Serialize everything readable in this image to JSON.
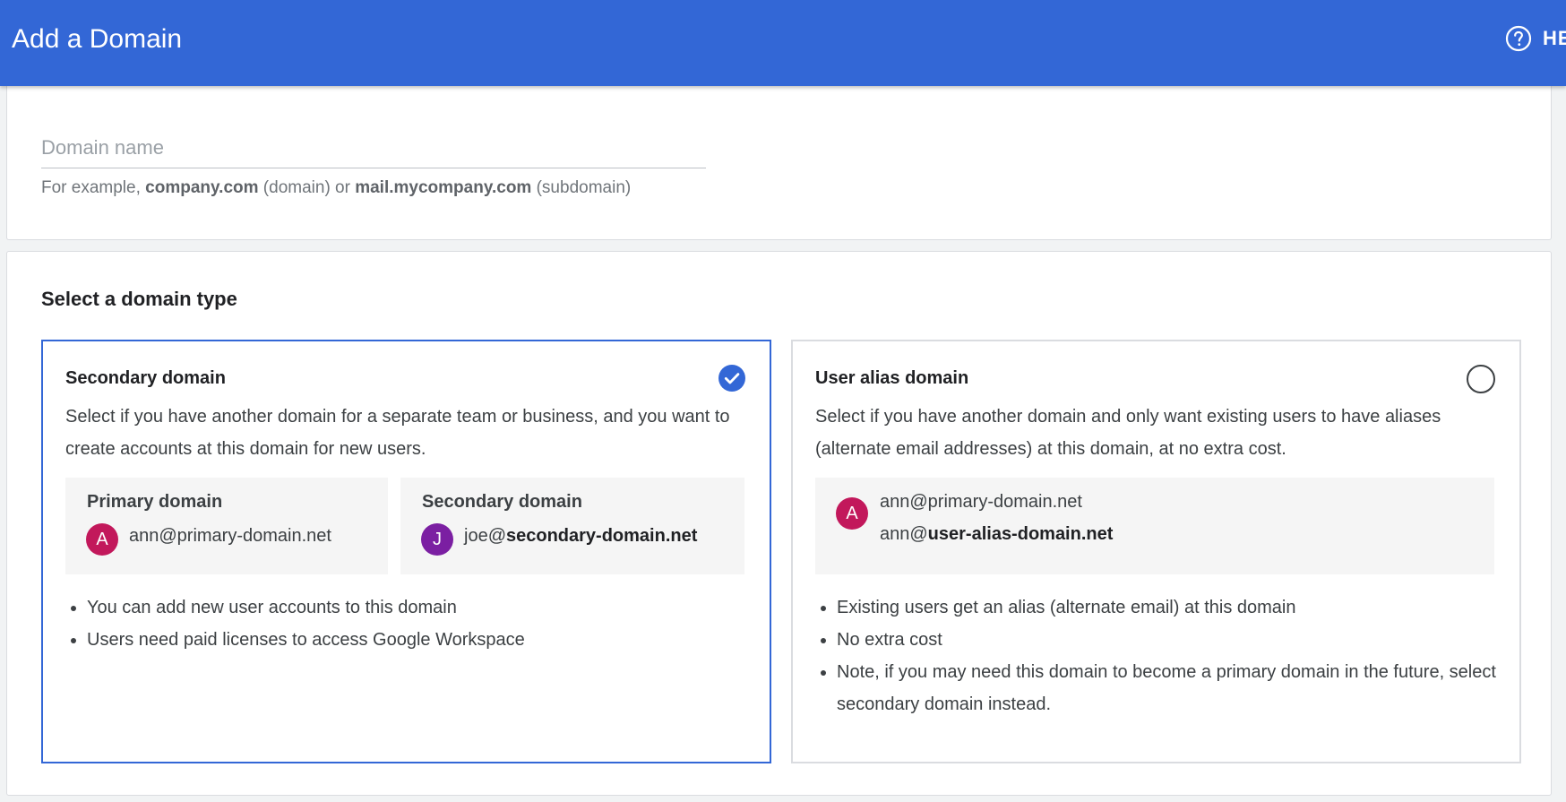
{
  "header": {
    "title": "Add a Domain",
    "help_label": "HE"
  },
  "domain_name": {
    "placeholder": "Domain name",
    "hint": {
      "prefix": "For example, ",
      "example_domain": "company.com",
      "domain_label": " (domain) or ",
      "example_subdomain": "mail.mycompany.com",
      "subdomain_label": " (subdomain)"
    }
  },
  "domain_type": {
    "section_title": "Select a domain type",
    "options": [
      {
        "title": "Secondary domain",
        "selected": true,
        "description": "Select if you have another domain for a separate team or business, and you want to create accounts at this domain for new users.",
        "examples": {
          "primary": {
            "heading": "Primary domain",
            "avatar": "A",
            "email": "ann@primary-domain.net"
          },
          "secondary": {
            "heading": "Secondary domain",
            "avatar": "J",
            "email_user": "joe@",
            "email_domain": "secondary-domain.net"
          }
        },
        "bullets": [
          "You can add new user accounts to this domain",
          "Users need paid licenses to access Google Workspace"
        ]
      },
      {
        "title": "User alias domain",
        "selected": false,
        "description": "Select if you have another domain and only want existing users to have aliases (alternate email addresses) at this domain, at no extra cost.",
        "example": {
          "avatar": "A",
          "email_primary": "ann@primary-domain.net",
          "alias_user": "ann@",
          "alias_domain": "user-alias-domain.net"
        },
        "bullets": [
          "Existing users get an alias (alternate email) at this domain",
          "No extra cost",
          "Note, if you may need this domain to become a primary domain in the future, select secondary domain instead."
        ]
      }
    ]
  },
  "colors": {
    "appbar": "#3367d6",
    "selected_border": "#3367d6",
    "avatar_ann": "#c2185b",
    "avatar_joe": "#7b1fa2"
  },
  "icons": {
    "help": "help-circle-icon",
    "selected": "check-circle-icon"
  }
}
